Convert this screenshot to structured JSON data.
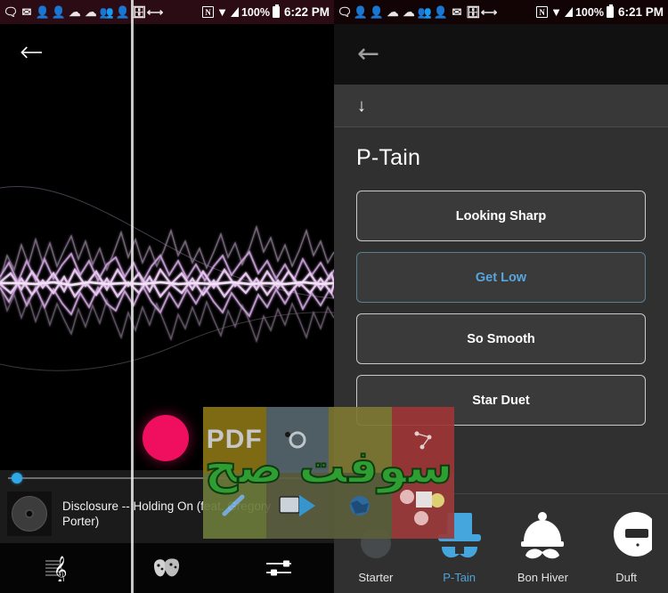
{
  "left_screen": {
    "status_bar": {
      "icons": [
        "message-icon",
        "email-icon",
        "person-icon",
        "person-icon",
        "cloud-icon",
        "cloud-icon",
        "download-person-icon",
        "person-icon",
        "inbox-icon",
        "sync-icon"
      ],
      "nfc_label": "N",
      "battery_percent": "100%",
      "time": "6:22 PM"
    },
    "nav": {
      "back_label": "←",
      "back_name": "back-arrow"
    },
    "visualizer": {
      "name": "audio-waveform-visualizer",
      "accent_color": "#c89ad6"
    },
    "record_button": {
      "name": "record-button",
      "color": "#ef0f5e"
    },
    "now_playing": {
      "track_title": "Disclosure -- Holding On (feat. Gregory Porter)",
      "seek_position_percent": 2,
      "seek_thumb_color": "#2fa8e8",
      "album_art": "vinyl-record-icon"
    },
    "tabs": [
      {
        "name": "tab-music",
        "icon": "treble-clef-icon"
      },
      {
        "name": "tab-masks",
        "icon": "theatre-masks-icon"
      },
      {
        "name": "tab-mixer",
        "icon": "equalizer-sliders-icon"
      }
    ]
  },
  "right_screen": {
    "status_bar": {
      "icons": [
        "message-icon",
        "person-icon",
        "person-icon",
        "cloud-icon",
        "cloud-icon",
        "download-person-icon",
        "person-icon",
        "gmail-icon",
        "inbox-icon",
        "sync-icon"
      ],
      "nfc_label": "N",
      "battery_percent": "100%",
      "time": "6:21 PM"
    },
    "nav": {
      "back_label": "←",
      "back_name": "back-arrow"
    },
    "download_row": {
      "icon": "download-arrow-icon",
      "label": "↓"
    },
    "heading": "P-Tain",
    "options": [
      {
        "label": "Looking Sharp",
        "selected": false
      },
      {
        "label": "Get Low",
        "selected": true
      },
      {
        "label": "So Smooth",
        "selected": false
      },
      {
        "label": "Star Duet",
        "selected": false
      }
    ],
    "selected_color": "#57a6dd",
    "tabs": [
      {
        "label": "Starter",
        "icon": "starter-icon",
        "active": false
      },
      {
        "label": "P-Tain",
        "icon": "top-hat-icon",
        "active": true
      },
      {
        "label": "Bon Hiver",
        "icon": "beanie-hat-icon",
        "active": false
      },
      {
        "label": "Duft",
        "icon": "helmet-icon",
        "active": false
      }
    ]
  },
  "watermark": {
    "pdf_label": "PDF",
    "arabic_label": "سوفت صح",
    "arabic_color": "#2e9e33"
  }
}
